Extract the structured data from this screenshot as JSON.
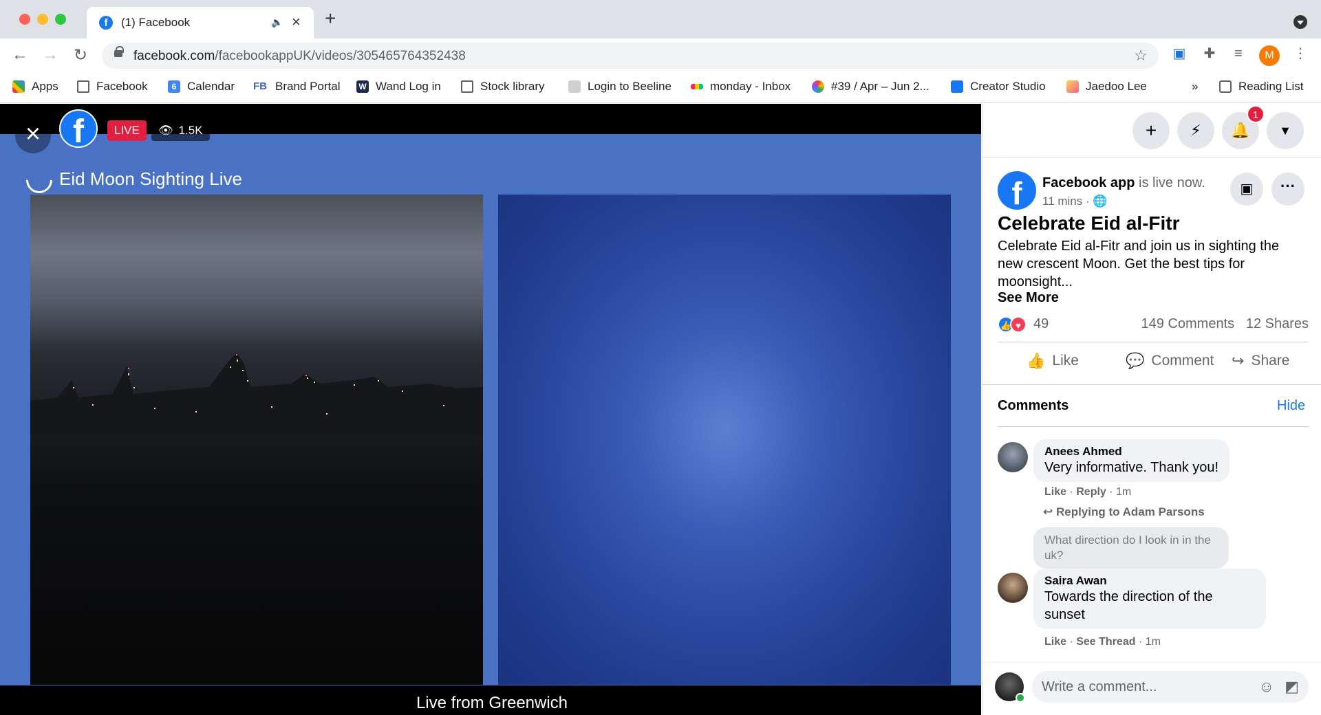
{
  "browser": {
    "tab_title": "(1) Facebook",
    "tab_favicon": "f",
    "url_domain": "facebook.com",
    "url_path": "/facebookappUK/videos/305465764352438",
    "profile_initial": "M",
    "bookmarks": [
      {
        "label": "Apps",
        "icon": "apps-grid-icon"
      },
      {
        "label": "Facebook",
        "icon": "folder-icon"
      },
      {
        "label": "Calendar",
        "icon": "calendar-icon",
        "icon_text": "6"
      },
      {
        "label": "Brand Portal",
        "icon": "fb-text-icon",
        "icon_text": "FB"
      },
      {
        "label": "Wand Log in",
        "icon": "w-icon",
        "icon_text": "W"
      },
      {
        "label": "Stock library",
        "icon": "folder-icon"
      },
      {
        "label": "Login to Beeline",
        "icon": "page-icon"
      },
      {
        "label": "monday - Inbox",
        "icon": "monday-icon"
      },
      {
        "label": "#39 / Apr – Jun 2...",
        "icon": "color-wheel-icon"
      },
      {
        "label": "Creator Studio",
        "icon": "creator-studio-icon"
      },
      {
        "label": "Jaedoo Lee",
        "icon": "square-icon"
      }
    ],
    "more_bookmarks": "»",
    "reading_list": "Reading List"
  },
  "video": {
    "live_label": "LIVE",
    "viewer_count": "1.5K",
    "broadcast_title": "Eid Moon Sighting Live",
    "caption": "Live from Greenwich"
  },
  "sidebar": {
    "notification_count": "1",
    "post": {
      "author": "Facebook app",
      "author_suffix": " is live now.",
      "time": "11 mins · ",
      "title": "Celebrate Eid al-Fitr",
      "body": "Celebrate Eid al-Fitr and join us in sighting the new crescent Moon. Get the best tips for moonsight...",
      "see_more": "See More",
      "reaction_count": "49",
      "comments_count": "149 Comments",
      "shares_count": "12 Shares"
    },
    "actions": {
      "like": "Like",
      "comment": "Comment",
      "share": "Share"
    },
    "comments_heading": "Comments",
    "hide_label": "Hide",
    "comments": [
      {
        "name": "Anees Ahmed",
        "text": "Very informative. Thank you!",
        "like": "Like",
        "reply": "Reply",
        "time": "1m"
      },
      {
        "replying_to": "Replying to Adam Parsons",
        "quoted": "What direction do I look in in the uk?",
        "name": "Saira Awan",
        "text": "Towards the direction of the sunset",
        "like": "Like",
        "see_thread": "See Thread",
        "time": "1m"
      }
    ],
    "write_placeholder": "Write a comment..."
  },
  "colors": {
    "facebook_blue": "#1877f2",
    "live_red": "#e41e3f",
    "frame_blue": "#4a72c4"
  }
}
